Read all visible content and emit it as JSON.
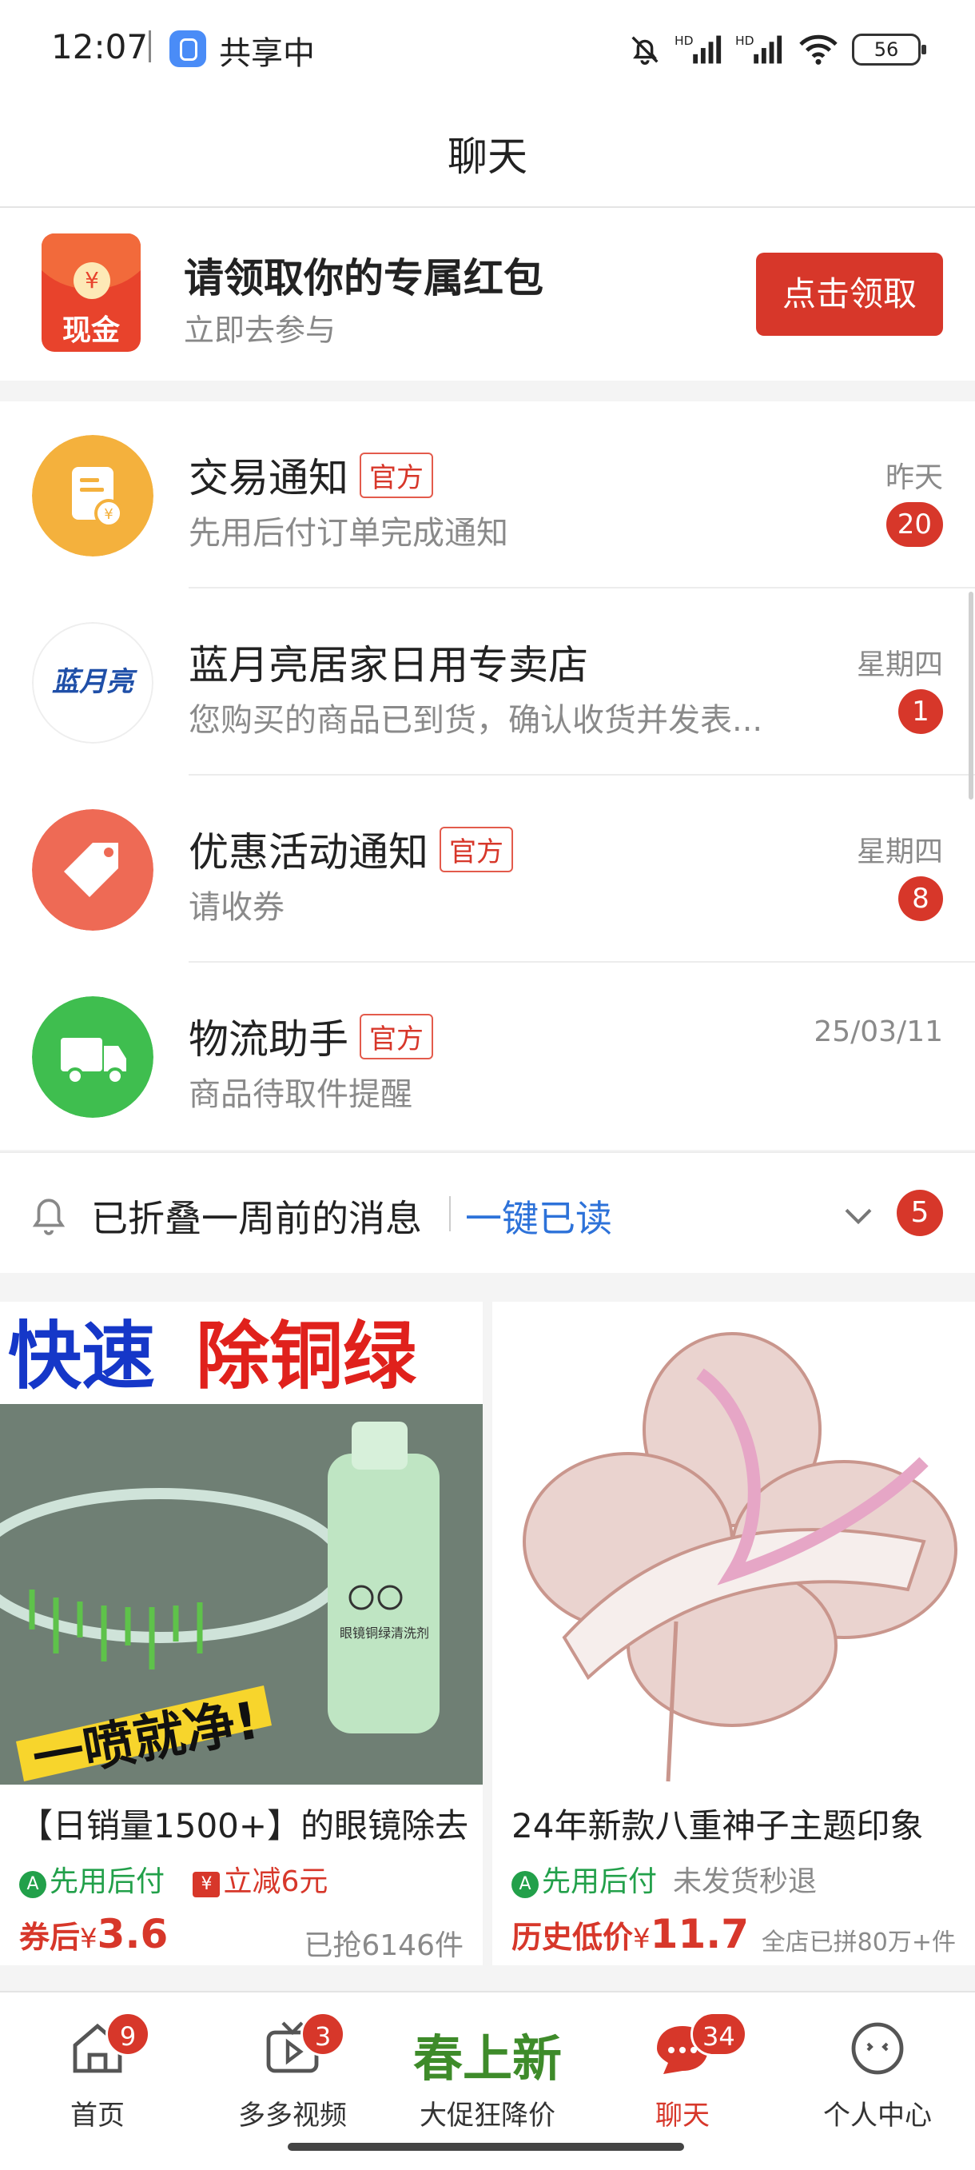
{
  "status_bar": {
    "time": "12:07",
    "share_text": "共享中",
    "battery": "56"
  },
  "header": {
    "title": "聊天"
  },
  "banner": {
    "icon_text": "现金",
    "icon_coin": "¥",
    "title": "请领取你的专属红包",
    "subtitle": "立即去参与",
    "button": "点击领取"
  },
  "chats": [
    {
      "name": "交易通知",
      "tag": "官方",
      "preview": "先用后付订单完成通知",
      "time": "昨天",
      "unread": "20",
      "avatar_icon": "receipt-icon",
      "avatar_color": "#f4b13d"
    },
    {
      "name": "蓝月亮居家日用专卖店",
      "tag": "",
      "preview": "您购买的商品已到货，确认收货并发表...",
      "time": "星期四",
      "unread": "1",
      "avatar_text": "蓝月亮",
      "avatar_color": "#ffffff"
    },
    {
      "name": "优惠活动通知",
      "tag": "官方",
      "preview": "请收券",
      "time": "星期四",
      "unread": "8",
      "avatar_icon": "price-tag-icon",
      "avatar_color": "#ee6a55"
    },
    {
      "name": "物流助手",
      "tag": "官方",
      "preview": "商品待取件提醒",
      "time": "25/03/11",
      "unread": "",
      "avatar_icon": "truck-icon",
      "avatar_color": "#3fbe4f"
    }
  ],
  "folded": {
    "text": "已折叠一周前的消息",
    "action": "一键已读",
    "count": "5"
  },
  "products": [
    {
      "image_headline_1": "快速",
      "image_headline_2": "除铜绿",
      "image_slogan": "一喷就净!",
      "bottle_label": "眼镜铜绿清洗剂",
      "title": "【日销量1500+】的眼镜除去",
      "pay_tag": "先用后付",
      "discount_tag": "立减6元",
      "price_label": "券后",
      "currency": "¥",
      "price": "3.6",
      "sold": "已抢6146件"
    },
    {
      "title": "24年新款八重神子主题印象",
      "pay_tag": "先用后付",
      "refund_tag": "未发货秒退",
      "price_label": "历史低价",
      "currency": "¥",
      "price": "11.7",
      "sold": "全店已拼80万+件"
    }
  ],
  "bottom_nav": [
    {
      "label": "首页",
      "badge": "9",
      "icon": "home-icon"
    },
    {
      "label": "多多视频",
      "badge": "3",
      "icon": "video-icon"
    },
    {
      "label": "大促狂降价",
      "promo": "春上新",
      "badge": ""
    },
    {
      "label": "聊天",
      "badge": "34",
      "icon": "chat-icon",
      "active": true
    },
    {
      "label": "个人中心",
      "badge": "",
      "icon": "profile-icon"
    }
  ],
  "colors": {
    "accent_red": "#d7372a",
    "link_blue": "#2d72d9",
    "promo_green": "#3e8b2a",
    "pay_green": "#22a04a"
  }
}
